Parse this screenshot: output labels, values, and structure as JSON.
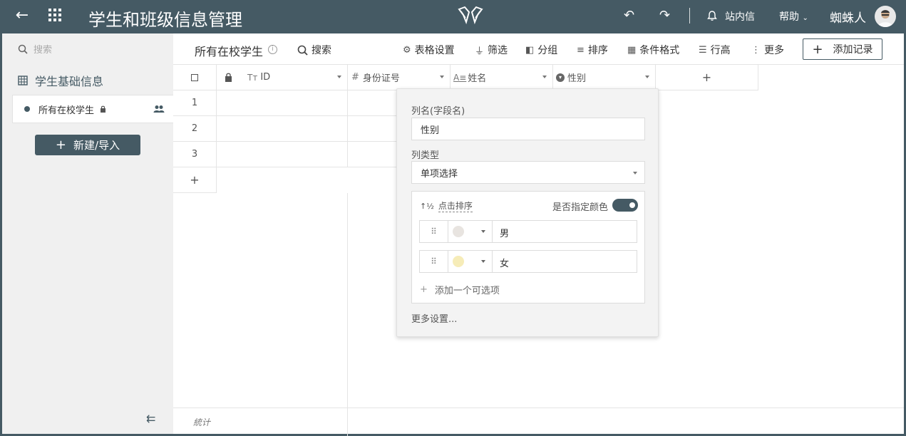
{
  "header": {
    "title": "学生和班级信息管理",
    "inbox_label": "站内信",
    "help_label": "帮助",
    "user_name": "蜘蛛人"
  },
  "sidebar": {
    "search_placeholder": "搜索",
    "group_label": "学生基础信息",
    "view_label": "所有在校学生",
    "new_button_label": "新建/导入"
  },
  "toolbar": {
    "view_name": "所有在校学生",
    "search": "搜索",
    "table_settings": "表格设置",
    "filter": "筛选",
    "group": "分组",
    "sort": "排序",
    "conditional_format": "条件格式",
    "row_height": "行高",
    "more": "更多",
    "add_record": "添加记录"
  },
  "grid": {
    "columns": [
      {
        "label": "ID",
        "icon": "text-type-icon"
      },
      {
        "label": "身份证号",
        "icon": "hash-icon"
      },
      {
        "label": "姓名",
        "icon": "text-field-icon"
      },
      {
        "label": "性别",
        "icon": "single-select-icon"
      }
    ],
    "row_numbers": [
      "1",
      "2",
      "3"
    ],
    "add_symbol": "+",
    "footer_label": "統计"
  },
  "field_popup": {
    "name_label": "列名(字段名)",
    "name_value": "性别",
    "type_label": "列类型",
    "type_value": "单项选择",
    "sort_label": "点击排序",
    "color_label": "是否指定颜色",
    "color_enabled": true,
    "options": [
      {
        "value": "男",
        "color": "#e8e4e0"
      },
      {
        "value": "女",
        "color": "#f6ecb8"
      }
    ],
    "add_option_label": "添加一个可选项",
    "more_settings": "更多设置..."
  },
  "colors": {
    "primary": "#455a64",
    "sidebar_bg": "#f0f0f0"
  }
}
